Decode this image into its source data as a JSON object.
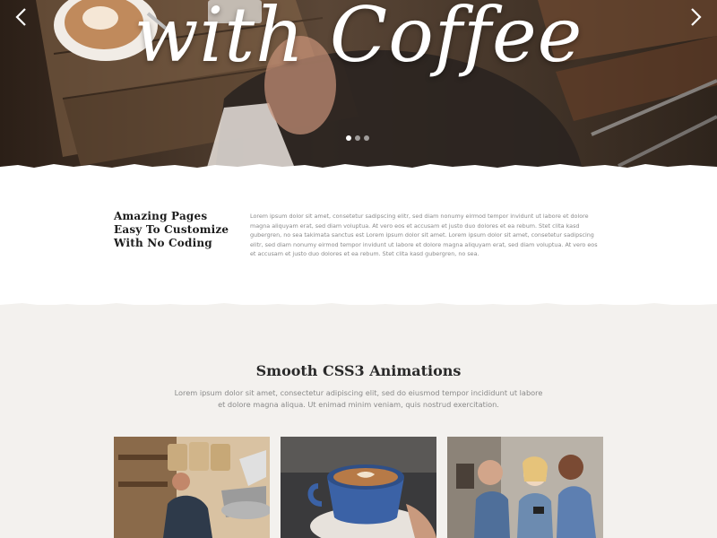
{
  "hero": {
    "title": "with Coffee",
    "prev_icon": "chevron-left-icon",
    "next_icon": "chevron-right-icon",
    "slides": 3,
    "active_slide": 1
  },
  "feature": {
    "heading_lines": [
      "Amazing Pages",
      "Easy To Customize",
      "With No Coding"
    ],
    "text": "Lorem ipsum dolor sit amet, consetetur sadipscing elitr, sed diam nonumy eirmod tempor invidunt ut labore et dolore magna aliquyam erat, sed diam voluptua. At vero eos et accusam et justo duo dolores et ea rebum. Stet clita kasd gubergren, no sea takimata sanctus est Lorem ipsum dolor sit amet. Lorem ipsum dolor sit amet, consetetur sadipscing elitr, sed diam nonumy eirmod tempor invidunt ut labore et dolore magna aliquyam erat, sed diam voluptua. At vero eos et accusam et justo duo dolores et ea rebum. Stet clita kasd gubergren, no sea."
  },
  "animations": {
    "title": "Smooth CSS3 Animations",
    "subtitle": "Lorem ipsum dolor sit amet, consectetur adipiscing elit, sed do eiusmod tempor incididunt ut labore et dolore magna aliqua. Ut enimad minim veniam, quis nostrud exercitation.",
    "cards": [
      "barista-roasting-photo",
      "latte-cup-photo",
      "baristas-smiling-photo"
    ]
  },
  "colors": {
    "hero_dark": "#3a2c22",
    "grey_bg": "#f3f1ee",
    "heading": "#1d1d1d",
    "body_text": "#8a8a8a"
  }
}
